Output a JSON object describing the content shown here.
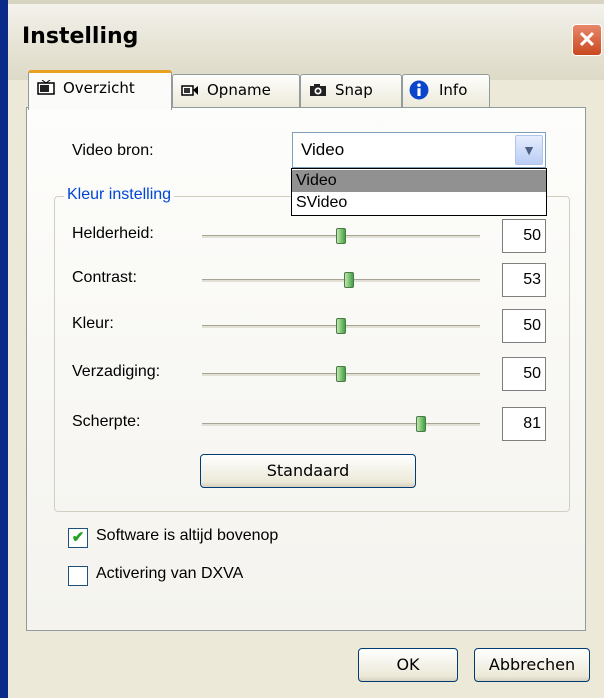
{
  "window": {
    "title": "Instelling"
  },
  "tabs": [
    {
      "label": "Overzicht",
      "icon": "tv-icon",
      "active": true
    },
    {
      "label": "Opname",
      "icon": "video-camera-icon",
      "active": false
    },
    {
      "label": "Snap",
      "icon": "photo-camera-icon",
      "active": false
    },
    {
      "label": "Info",
      "icon": "info-icon",
      "active": false
    }
  ],
  "video_source": {
    "label": "Video bron:",
    "selected": "Video",
    "options": [
      "Video",
      "SVideo"
    ],
    "highlighted": "Video"
  },
  "color_group": {
    "title": "Kleur instelling",
    "sliders": [
      {
        "label": "Helderheid:",
        "value": "50",
        "min": 0,
        "max": 100
      },
      {
        "label": "Contrast:",
        "value": "53",
        "min": 0,
        "max": 100
      },
      {
        "label": "Kleur:",
        "value": "50",
        "min": 0,
        "max": 100
      },
      {
        "label": "Verzadiging:",
        "value": "50",
        "min": 0,
        "max": 100
      },
      {
        "label": "Scherpte:",
        "value": "81",
        "min": 0,
        "max": 100
      }
    ],
    "default_button": "Standaard"
  },
  "checkboxes": [
    {
      "label": "Software is altijd bovenop",
      "checked": true
    },
    {
      "label": "Activering van DXVA",
      "checked": false
    }
  ],
  "buttons": {
    "ok": "OK",
    "cancel": "Abbrechen"
  },
  "colors": {
    "group_title": "#0046d5",
    "active_tab_accent": "#e8a020",
    "close_button": "#c9481f",
    "slider_thumb": "#3fa33f"
  }
}
